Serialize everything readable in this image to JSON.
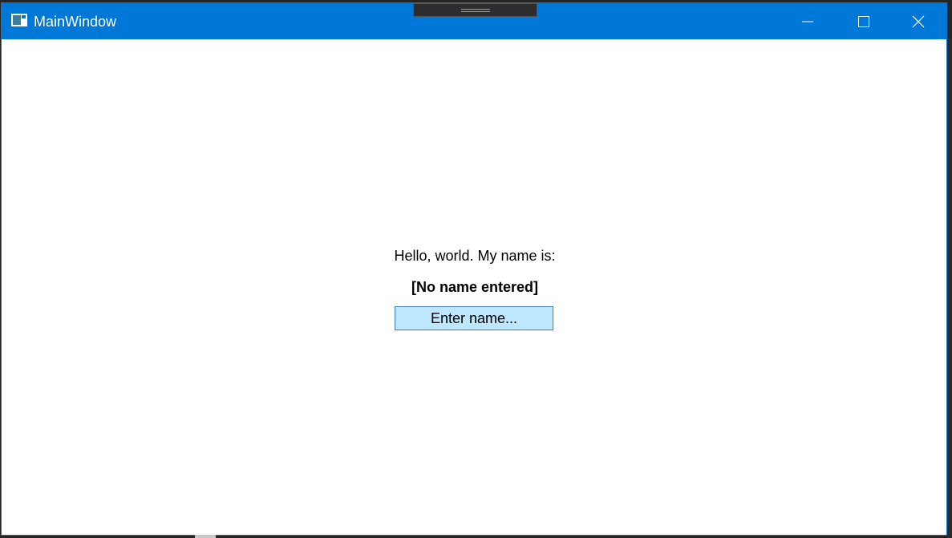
{
  "window": {
    "title": "MainWindow",
    "controls": {
      "minimize_icon": "minimize-icon",
      "maximize_icon": "maximize-icon",
      "close_icon": "close-icon"
    }
  },
  "main": {
    "greeting": "Hello, world. My name is:",
    "name_value": "[No name entered]",
    "enter_button_label": "Enter name..."
  },
  "colors": {
    "titlebar": "#0078d7",
    "button_bg": "#bee6fd",
    "button_border": "#3c7fb1"
  }
}
